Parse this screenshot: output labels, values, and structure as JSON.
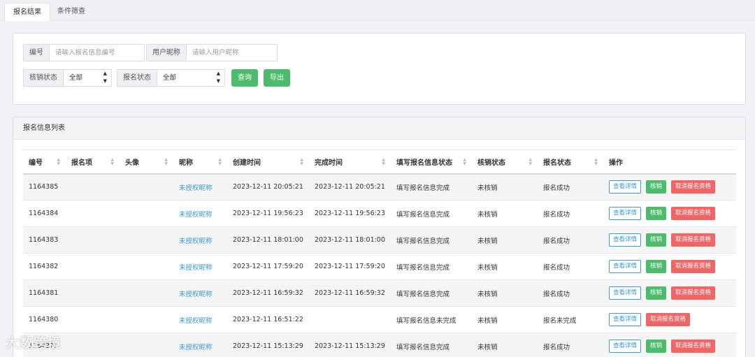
{
  "tabs": [
    {
      "label": "报名结果",
      "active": true
    },
    {
      "label": "条件筛查",
      "active": false
    }
  ],
  "filters": {
    "id_label": "编号",
    "id_placeholder": "请输入报名信息编号",
    "nickname_label": "用户昵称",
    "nickname_placeholder": "请输入用户昵称",
    "verify_label": "核销状态",
    "verify_value": "全部",
    "status_label": "报名状态",
    "status_value": "全部",
    "search_button": "查询",
    "export_button": "导出"
  },
  "list": {
    "title": "报名信息列表",
    "columns": [
      "编号",
      "报名项",
      "头像",
      "昵称",
      "创建时间",
      "完成时间",
      "填写报名信息状态",
      "核销状态",
      "报名状态",
      "操作"
    ],
    "action_labels": {
      "detail": "查看详情",
      "verify": "核销",
      "cancel": "取消报名资格"
    },
    "rows": [
      {
        "id": "1164385",
        "item": "",
        "avatar": "",
        "nickname": "未授权昵称",
        "created": "2023-12-11 20:05:21",
        "finished": "2023-12-11 20:05:21",
        "fill_status": "填写报名信息完成",
        "verify_status": "未核销",
        "signup_status": "报名成功"
      },
      {
        "id": "1164384",
        "item": "",
        "avatar": "",
        "nickname": "未授权昵称",
        "created": "2023-12-11 19:56:23",
        "finished": "2023-12-11 19:56:23",
        "fill_status": "填写报名信息完成",
        "verify_status": "未核销",
        "signup_status": "报名成功"
      },
      {
        "id": "1164383",
        "item": "",
        "avatar": "",
        "nickname": "未授权昵称",
        "created": "2023-12-11 18:01:00",
        "finished": "2023-12-11 18:01:00",
        "fill_status": "填写报名信息完成",
        "verify_status": "未核销",
        "signup_status": "报名成功"
      },
      {
        "id": "1164382",
        "item": "",
        "avatar": "",
        "nickname": "未授权昵称",
        "created": "2023-12-11 17:59:20",
        "finished": "2023-12-11 17:59:20",
        "fill_status": "填写报名信息完成",
        "verify_status": "未核销",
        "signup_status": "报名成功"
      },
      {
        "id": "1164381",
        "item": "",
        "avatar": "",
        "nickname": "未授权昵称",
        "created": "2023-12-11 16:59:32",
        "finished": "2023-12-11 16:59:32",
        "fill_status": "填写报名信息完成",
        "verify_status": "未核销",
        "signup_status": "报名成功"
      },
      {
        "id": "1164380",
        "item": "",
        "avatar": "",
        "nickname": "未授权昵称",
        "created": "2023-12-11 16:51:22",
        "finished": "",
        "fill_status": "填写报名信息未完成",
        "verify_status": "未核销",
        "signup_status": "报名未完成"
      },
      {
        "id": "11643??",
        "item": "",
        "avatar": "",
        "nickname": "未授权昵称",
        "created": "2023-12-11 15:13:29",
        "finished": "2023-12-11 15:13:29",
        "fill_status": "填写报名信息完成",
        "verify_status": "未核销",
        "signup_status": "报名成功"
      }
    ]
  },
  "watermark": "大数跨境"
}
